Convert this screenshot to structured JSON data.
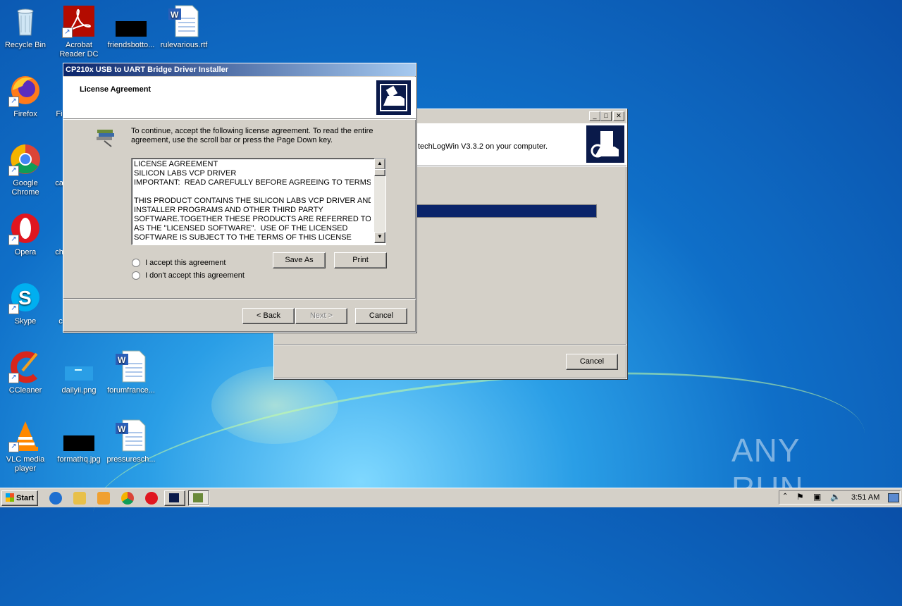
{
  "desktop_icons": [
    {
      "label": "Recycle Bin"
    },
    {
      "label": "Acrobat Reader DC"
    },
    {
      "label": "friendsbotto..."
    },
    {
      "label": "rulevarious.rtf"
    },
    {
      "label": "Firefox"
    },
    {
      "label": "Google Chrome"
    },
    {
      "label": "Opera"
    },
    {
      "label": "Skype"
    },
    {
      "label": "CCleaner"
    },
    {
      "label": "dailyii.png"
    },
    {
      "label": "forumfrance..."
    },
    {
      "label": "VLC media player"
    },
    {
      "label": "formathq.jpg"
    },
    {
      "label": "pressuresch..."
    }
  ],
  "partial_labels": {
    "fi": "Fi",
    "ca": "ca",
    "ch": "ch",
    "c": "c"
  },
  "back_window": {
    "header_text": "techLogWin V3.3.2 on your computer.",
    "cancel_label": "Cancel",
    "progress": 1.0
  },
  "dialog": {
    "title": "CP210x USB to UART Bridge Driver Installer",
    "header": "License Agreement",
    "instruction": "To continue, accept the following license agreement. To read the entire agreement, use the scroll bar or press the Page Down key.",
    "license_lines": [
      "LICENSE AGREEMENT",
      "SILICON LABS VCP DRIVER",
      "IMPORTANT:  READ CAREFULLY BEFORE AGREEING TO TERMS",
      "",
      "THIS PRODUCT CONTAINS THE SILICON LABS VCP DRIVER AND",
      "INSTALLER PROGRAMS AND OTHER THIRD PARTY",
      "SOFTWARE.TOGETHER THESE PRODUCTS ARE REFERRED TO",
      "AS THE \"LICENSED SOFTWARE\".  USE OF THE LICENSED",
      "SOFTWARE IS SUBJECT TO THE TERMS OF THIS LICENSE"
    ],
    "accept_label": "I accept this agreement",
    "decline_label": "I don't accept this agreement",
    "save_as_label": "Save As",
    "print_label": "Print",
    "back_label": "< Back",
    "next_label": "Next >",
    "cancel_label": "Cancel"
  },
  "taskbar": {
    "start_label": "Start",
    "clock": "3:51 AM"
  },
  "watermark": "ANY RUN"
}
